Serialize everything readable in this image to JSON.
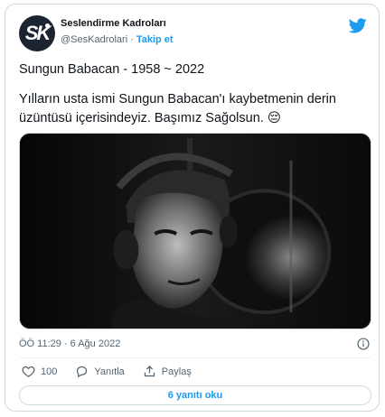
{
  "account": {
    "display_name": "Seslendirme Kadroları",
    "handle": "@SesKadrolari",
    "separator": "·",
    "follow_label": "Takip et",
    "avatar_initials": "SK"
  },
  "tweet": {
    "line1": "Sungun Babacan - 1958 ~ 2022",
    "line2": "Yılların usta ismi Sungun Babacan'ı kaybetmenin derin üzüntüsü içerisindeyiz. Başımız Sağolsun. 😔",
    "timestamp": "ÖÖ 11:29 · 6 Ağu 2022"
  },
  "actions": {
    "like_count": "100",
    "reply_label": "Yanıtla",
    "share_label": "Paylaş"
  },
  "replies_button": "6 yanıtı oku",
  "colors": {
    "accent": "#1d9bf0",
    "secondary_text": "#536471",
    "border": "#cfd9de"
  },
  "icons": [
    "twitter-bird-icon",
    "info-icon",
    "heart-icon",
    "reply-icon",
    "share-icon"
  ]
}
